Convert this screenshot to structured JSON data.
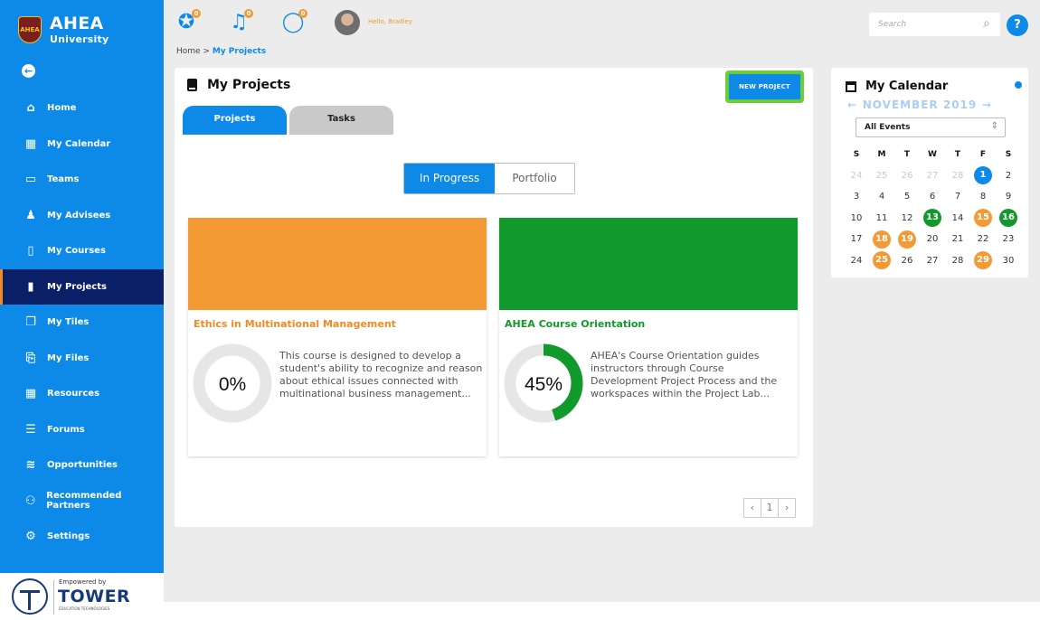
{
  "sidebar": {
    "brand_name": "AHEA",
    "brand_sub": "University",
    "crest_text": "AHEA",
    "back_icon": "arrow-left-circle-icon",
    "items": [
      {
        "label": "Home",
        "icon": "home-icon",
        "glyph": "⌂"
      },
      {
        "label": "My Calendar",
        "icon": "calendar-icon",
        "glyph": "▦"
      },
      {
        "label": "Teams",
        "icon": "teams-icon",
        "glyph": "▭"
      },
      {
        "label": "My Advisees",
        "icon": "advisees-icon",
        "glyph": "♟"
      },
      {
        "label": "My Courses",
        "icon": "courses-icon",
        "glyph": "▯"
      },
      {
        "label": "My Projects",
        "icon": "projects-icon",
        "glyph": "▮"
      },
      {
        "label": "My Tiles",
        "icon": "tiles-icon",
        "glyph": "❐"
      },
      {
        "label": "My Files",
        "icon": "files-icon",
        "glyph": "⎘"
      },
      {
        "label": "Resources",
        "icon": "resources-icon",
        "glyph": "▦"
      },
      {
        "label": "Forums",
        "icon": "forums-icon",
        "glyph": "☰"
      },
      {
        "label": "Opportunities",
        "icon": "opportunities-icon",
        "glyph": "≋"
      },
      {
        "label": "Recommended Partners",
        "icon": "partners-icon",
        "glyph": "⚇"
      },
      {
        "label": "Settings",
        "icon": "settings-icon",
        "glyph": "⚙"
      }
    ],
    "active_index": 5,
    "powered_small": "Empowered by",
    "powered_big": "TOWER",
    "powered_tiny": "EDUCATION TECHNOLOGIES"
  },
  "topbar": {
    "badges": [
      "0",
      "0",
      "0"
    ],
    "hello": "Hello, Bradley",
    "search_placeholder": "Search",
    "help": "?"
  },
  "breadcrumb": {
    "home": "Home",
    "separator": " > ",
    "current": "My Projects"
  },
  "projects": {
    "title": "My Projects",
    "new_button": "NEW PROJECT",
    "tabs": [
      "Projects",
      "Tasks"
    ],
    "toggle": [
      "In Progress",
      "Portfolio"
    ],
    "cards": [
      {
        "title": "Ethics in Multinational Management",
        "progress_label": "0%",
        "progress": 0,
        "color": "#f39a34",
        "title_color": "#f08a24",
        "description": "This course is designed to develop a student's ability to recognize and reason about ethical issues connected with multinational business management..."
      },
      {
        "title": "AHEA Course Orientation",
        "progress_label": "45%",
        "progress": 0.45,
        "color": "#119a2b",
        "title_color": "#119a2b",
        "description": "AHEA's Course Orientation guides instructors through Course Development Project Process and the workspaces within the Project Lab..."
      }
    ],
    "pager": [
      "‹",
      "1",
      "›"
    ]
  },
  "calendar": {
    "title": "My Calendar",
    "month": "NOVEMBER 2019",
    "prev": "←",
    "next": "→",
    "filter": "All Events",
    "weekdays": [
      "S",
      "M",
      "T",
      "W",
      "T",
      "F",
      "S"
    ],
    "weeks": [
      [
        {
          "d": "24",
          "m": true
        },
        {
          "d": "25",
          "m": true
        },
        {
          "d": "26",
          "m": true
        },
        {
          "d": "27",
          "m": true
        },
        {
          "d": "28",
          "m": true
        },
        {
          "d": "1",
          "e": "blue"
        },
        {
          "d": "2"
        }
      ],
      [
        {
          "d": "3"
        },
        {
          "d": "4"
        },
        {
          "d": "5"
        },
        {
          "d": "6"
        },
        {
          "d": "7"
        },
        {
          "d": "8"
        },
        {
          "d": "9"
        }
      ],
      [
        {
          "d": "10"
        },
        {
          "d": "11"
        },
        {
          "d": "12"
        },
        {
          "d": "13",
          "e": "green"
        },
        {
          "d": "14"
        },
        {
          "d": "15",
          "e": "orange"
        },
        {
          "d": "16",
          "e": "green"
        }
      ],
      [
        {
          "d": "17"
        },
        {
          "d": "18",
          "e": "orange"
        },
        {
          "d": "19",
          "e": "orange"
        },
        {
          "d": "20"
        },
        {
          "d": "21"
        },
        {
          "d": "22"
        },
        {
          "d": "23"
        }
      ],
      [
        {
          "d": "24"
        },
        {
          "d": "25",
          "e": "orange"
        },
        {
          "d": "26"
        },
        {
          "d": "27"
        },
        {
          "d": "28"
        },
        {
          "d": "29",
          "e": "orange"
        },
        {
          "d": "30"
        }
      ]
    ]
  }
}
